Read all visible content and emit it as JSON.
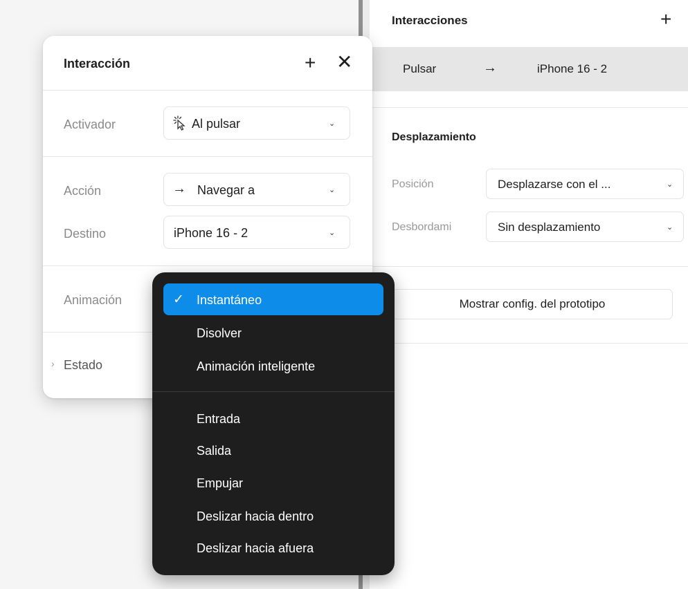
{
  "panel": {
    "title": "Interacciones",
    "plus_icon": "+",
    "interaction": {
      "trigger": "Pulsar",
      "arrow": "→",
      "target": "iPhone 16 - 2"
    },
    "scroll_section": {
      "title": "Desplazamiento",
      "position_label": "Posición",
      "position_value": "Desplazarse con el ...",
      "overflow_label": "Desbordami",
      "overflow_value": "Sin desplazamiento"
    },
    "settings_button": "Mostrar config. del prototipo"
  },
  "modal": {
    "title": "Interacción",
    "plus_icon": "+",
    "close_icon": "✕",
    "trigger_label": "Activador",
    "trigger_icon": "tap-cursor-icon",
    "trigger_value": "Al pulsar",
    "action_label": "Acción",
    "action_arrow": "→",
    "action_value": "Navegar a",
    "destination_label": "Destino",
    "destination_value": "iPhone 16 - 2",
    "animation_label": "Animación",
    "state_label": "Estado",
    "state_chevron": "›"
  },
  "menu": {
    "check": "✓",
    "items_group1": [
      "Instantáneo",
      "Disolver",
      "Animación inteligente"
    ],
    "items_group2": [
      "Entrada",
      "Salida",
      "Empujar",
      "Deslizar hacia dentro",
      "Deslizar hacia afuera"
    ]
  },
  "chevron": "⌄",
  "colors": {
    "accent": "#0d8ce9",
    "menu_bg": "#1e1e1e",
    "row_highlight": "#e6e6e6"
  }
}
